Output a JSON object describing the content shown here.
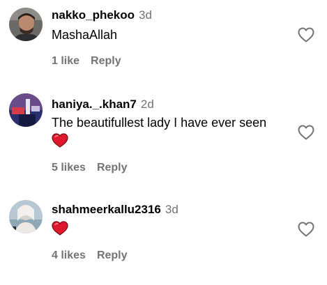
{
  "comments": [
    {
      "username": "nakko_phekoo",
      "time": "3d",
      "text": "MashaAllah",
      "likes": "1 like",
      "reply": "Reply",
      "avatar_icon": "user-avatar",
      "like_icon": "heart-outline-icon"
    },
    {
      "username": "haniya._.khan7",
      "time": "2d",
      "text": "The beautifullest lady I have ever seen",
      "likes": "5 likes",
      "reply": "Reply",
      "avatar_icon": "user-avatar",
      "emoji_icon": "red-heart-emoji",
      "like_icon": "heart-outline-icon"
    },
    {
      "username": "shahmeerkallu2316",
      "time": "3d",
      "text": "",
      "likes": "4 likes",
      "reply": "Reply",
      "avatar_icon": "user-avatar",
      "emoji_icon": "red-heart-emoji",
      "like_icon": "heart-outline-icon"
    }
  ],
  "colors": {
    "secondary_text": "#737373",
    "heart_emoji": "#e0182d",
    "outline_icon": "#737373"
  }
}
